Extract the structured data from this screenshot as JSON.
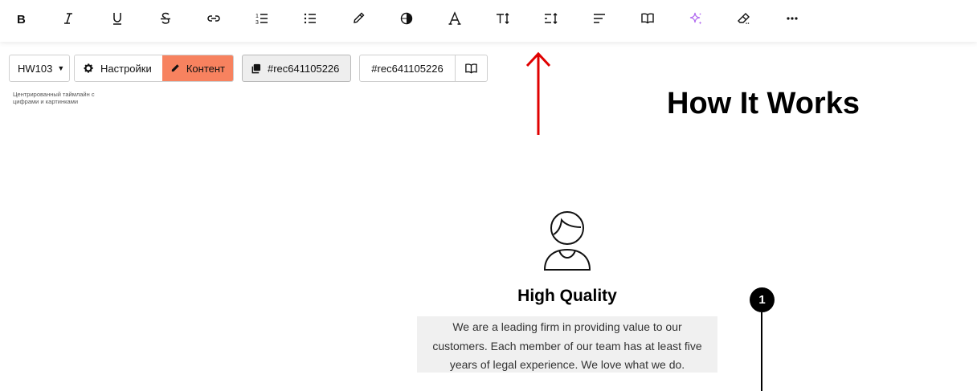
{
  "toolbar": {
    "items": [
      {
        "name": "bold-icon"
      },
      {
        "name": "italic-icon"
      },
      {
        "name": "underline-icon"
      },
      {
        "name": "strikethrough-icon"
      },
      {
        "name": "link-icon"
      },
      {
        "name": "ordered-list-icon"
      },
      {
        "name": "bullet-list-icon"
      },
      {
        "name": "color-picker-icon"
      },
      {
        "name": "background-color-icon"
      },
      {
        "name": "font-icon"
      },
      {
        "name": "font-size-icon"
      },
      {
        "name": "line-height-icon"
      },
      {
        "name": "align-left-icon"
      },
      {
        "name": "book-icon"
      },
      {
        "name": "sparkle-ai-icon"
      },
      {
        "name": "eraser-icon"
      },
      {
        "name": "more-icon"
      }
    ]
  },
  "controls": {
    "block_type": "HW103",
    "settings_label": "Настройки",
    "content_label": "Контент",
    "record_id_primary": "#rec641105226",
    "record_id_secondary": "#rec641105226",
    "description": "Центрированный таймлайн с цифрами и картинками",
    "accent_color": "#f7825f"
  },
  "annotation": {
    "arrow_color": "#e00000"
  },
  "main": {
    "title": "How It Works",
    "item": {
      "icon": "person-icon",
      "title": "High Quality",
      "text": "We are a leading firm in providing value to our customers. Each member of our team has at least five years of legal experience. We love what we do.",
      "number": "1"
    }
  }
}
